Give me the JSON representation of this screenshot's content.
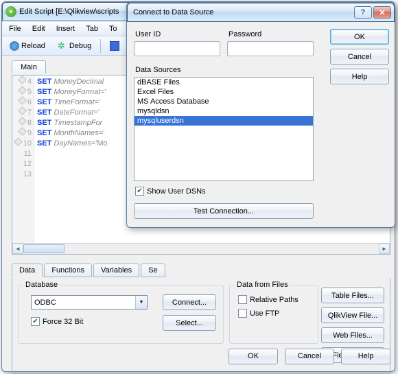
{
  "mainWindow": {
    "title": "Edit Script [E:\\Qlikview\\scripts",
    "menu": [
      "File",
      "Edit",
      "Insert",
      "Tab",
      "To"
    ],
    "toolbar": {
      "reload": "Reload",
      "debug": "Debug"
    },
    "scriptTabs": [
      "Main"
    ],
    "gutter": [
      "4",
      "5",
      "6",
      "7",
      "8",
      "9",
      "10",
      "11",
      "12",
      "13"
    ],
    "code": [
      [
        "SET ",
        "MoneyDecimal"
      ],
      [
        "SET ",
        "MoneyFormat",
        "='"
      ],
      [
        "SET ",
        "TimeFormat",
        "='"
      ],
      [
        "SET ",
        "DateFormat",
        "='"
      ],
      [
        "SET ",
        "TimestampFor"
      ],
      [
        "SET ",
        "MonthNames",
        "='"
      ],
      [
        "SET ",
        "DayNames",
        "='Mo"
      ]
    ],
    "lowerTabs": [
      "Data",
      "Functions",
      "Variables",
      "Se"
    ],
    "database": {
      "legend": "Database",
      "combo": "ODBC",
      "force32": "Force 32 Bit",
      "connect": "Connect...",
      "select": "Select..."
    },
    "files": {
      "legend": "Data from Files",
      "relative": "Relative Paths",
      "useftp": "Use FTP"
    },
    "sideButtons": [
      "Table Files...",
      "QlikView File...",
      "Web Files...",
      "Field Data..."
    ],
    "bottom": {
      "ok": "OK",
      "cancel": "Cancel",
      "help": "Help"
    }
  },
  "dialog": {
    "title": "Connect to Data Source",
    "userid_label": "User ID",
    "password_label": "Password",
    "userid": "",
    "password": "",
    "ds_label": "Data Sources",
    "items": [
      "dBASE Files",
      "Excel Files",
      "MS Access Database",
      "mysqldsn",
      "mysqluserdsn"
    ],
    "selectedIndex": 4,
    "showUserDSNs": "Show User DSNs",
    "testConnection": "Test Connection...",
    "ok": "OK",
    "cancel": "Cancel",
    "help": "Help"
  }
}
